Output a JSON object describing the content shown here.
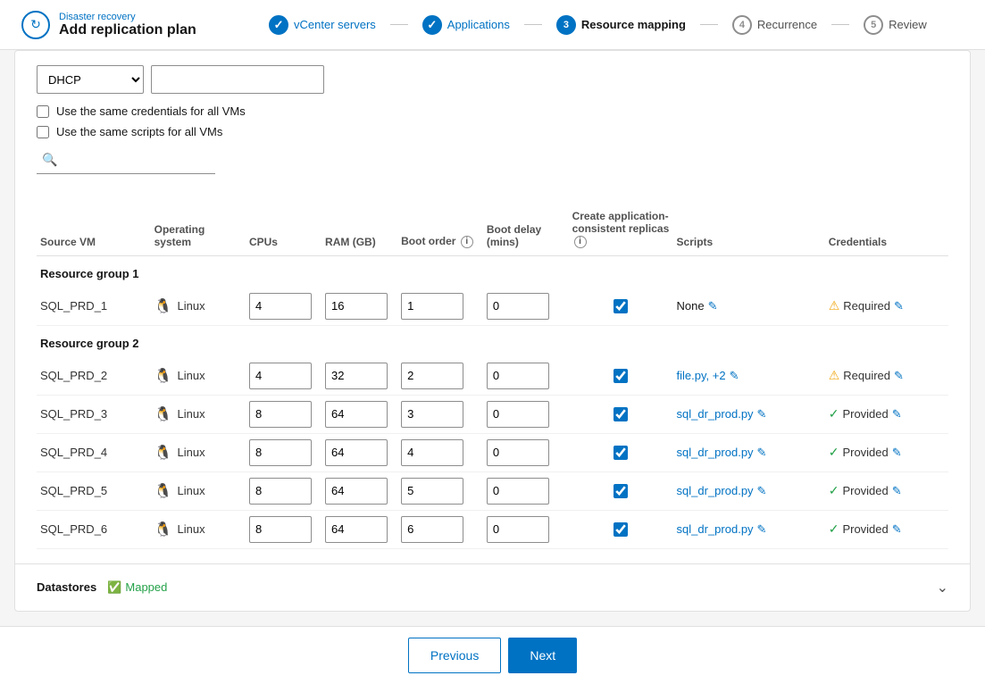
{
  "header": {
    "subtitle": "Disaster recovery",
    "title": "Add replication plan",
    "icon": "↻"
  },
  "stepper": {
    "steps": [
      {
        "id": 1,
        "label": "vCenter servers",
        "state": "completed"
      },
      {
        "id": 2,
        "label": "Applications",
        "state": "completed"
      },
      {
        "id": 3,
        "label": "Resource mapping",
        "state": "active"
      },
      {
        "id": 4,
        "label": "Recurrence",
        "state": "upcoming"
      },
      {
        "id": 5,
        "label": "Review",
        "state": "upcoming"
      }
    ]
  },
  "form": {
    "dhcp_label": "DHCP",
    "same_credentials_label": "Use the same credentials for all VMs",
    "same_scripts_label": "Use the same scripts for all VMs",
    "search_placeholder": ""
  },
  "table": {
    "headers": {
      "source_vm": "Source VM",
      "operating_system": "Operating system",
      "cpus": "CPUs",
      "ram_gb": "RAM (GB)",
      "boot_order": "Boot order",
      "boot_delay": "Boot delay (mins)",
      "replicas": "Create application-consistent replicas",
      "scripts": "Scripts",
      "credentials": "Credentials"
    },
    "groups": [
      {
        "name": "Resource group 1",
        "vms": [
          {
            "source_vm": "SQL_PRD_1",
            "os": "Linux",
            "cpus": "4",
            "ram": "16",
            "boot_order": "1",
            "boot_delay": "0",
            "replica_checked": true,
            "scripts": "None",
            "has_script_edit": true,
            "cred_status": "warning",
            "cred_label": "Required",
            "has_cred_edit": true
          }
        ]
      },
      {
        "name": "Resource group 2",
        "vms": [
          {
            "source_vm": "SQL_PRD_2",
            "os": "Linux",
            "cpus": "4",
            "ram": "32",
            "boot_order": "2",
            "boot_delay": "0",
            "replica_checked": true,
            "scripts": "file.py, +2",
            "has_script_edit": true,
            "cred_status": "warning",
            "cred_label": "Required",
            "has_cred_edit": true
          },
          {
            "source_vm": "SQL_PRD_3",
            "os": "Linux",
            "cpus": "8",
            "ram": "64",
            "boot_order": "3",
            "boot_delay": "0",
            "replica_checked": true,
            "scripts": "sql_dr_prod.py",
            "has_script_edit": true,
            "cred_status": "success",
            "cred_label": "Provided",
            "has_cred_edit": true
          },
          {
            "source_vm": "SQL_PRD_4",
            "os": "Linux",
            "cpus": "8",
            "ram": "64",
            "boot_order": "4",
            "boot_delay": "0",
            "replica_checked": true,
            "scripts": "sql_dr_prod.py",
            "has_script_edit": true,
            "cred_status": "success",
            "cred_label": "Provided",
            "has_cred_edit": true
          },
          {
            "source_vm": "SQL_PRD_5",
            "os": "Linux",
            "cpus": "8",
            "ram": "64",
            "boot_order": "5",
            "boot_delay": "0",
            "replica_checked": true,
            "scripts": "sql_dr_prod.py",
            "has_script_edit": true,
            "cred_status": "success",
            "cred_label": "Provided",
            "has_cred_edit": true
          },
          {
            "source_vm": "SQL_PRD_6",
            "os": "Linux",
            "cpus": "8",
            "ram": "64",
            "boot_order": "6",
            "boot_delay": "0",
            "replica_checked": true,
            "scripts": "sql_dr_prod.py",
            "has_script_edit": true,
            "cred_status": "success",
            "cred_label": "Provided",
            "has_cred_edit": true
          }
        ]
      }
    ]
  },
  "datastores": {
    "label": "Datastores",
    "status": "Mapped"
  },
  "footer": {
    "previous_label": "Previous",
    "next_label": "Next"
  }
}
